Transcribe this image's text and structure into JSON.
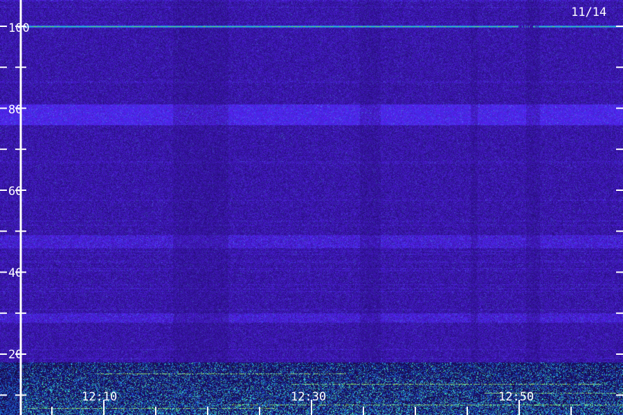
{
  "date_label": "11/14",
  "colors": {
    "background": "#2a0a6e",
    "band": "#3a2cc8",
    "hot": "#4ef26a",
    "axis": "#ffffff"
  },
  "chart_data": {
    "type": "heatmap",
    "title": "",
    "xlabel": "",
    "ylabel": "",
    "x_tick_labels": [
      "12:10",
      "12:30",
      "12:50"
    ],
    "y_tick_labels": [
      "20",
      "40",
      "60",
      "80",
      "100"
    ],
    "ylim": [
      0,
      103
    ],
    "grid": false,
    "y_ticks_minor_step": 10,
    "bright_lines": [
      {
        "y": 100,
        "intensity": "high"
      }
    ],
    "faint_bands": [
      {
        "y_min": 76,
        "y_max": 81,
        "intensity": "medium"
      },
      {
        "y_min": 46,
        "y_max": 49,
        "intensity": "low"
      },
      {
        "y_min": 28,
        "y_max": 30,
        "intensity": "low"
      }
    ],
    "low_frequency_activity": {
      "y_min": 0,
      "y_max": 18,
      "intensity": "high"
    }
  }
}
